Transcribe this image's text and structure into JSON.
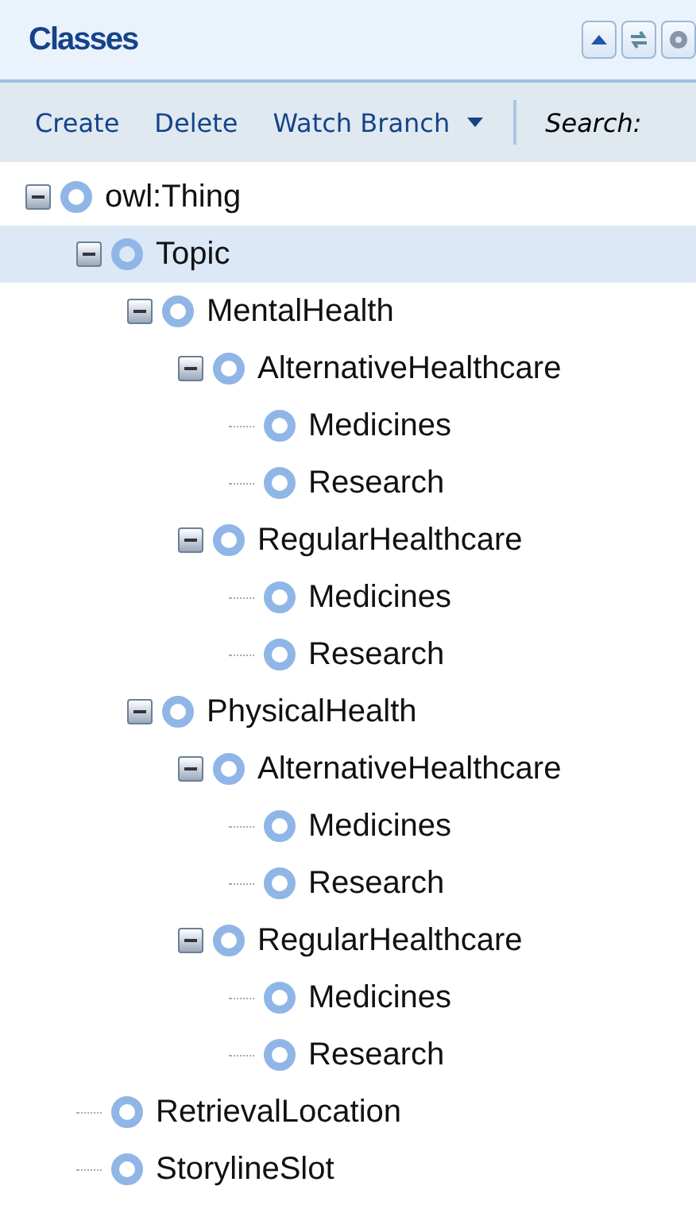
{
  "panel": {
    "title": "Classes"
  },
  "header_buttons": [
    {
      "kind": "up"
    },
    {
      "kind": "sync"
    },
    {
      "kind": "settings"
    }
  ],
  "toolbar": {
    "actions": [
      "Create",
      "Delete"
    ],
    "dropdown": "Watch Branch",
    "search_label": "Search:"
  },
  "tree": [
    {
      "label": "owl:Thing",
      "selected": false,
      "expanded": true,
      "children": [
        {
          "label": "Topic",
          "selected": true,
          "expanded": true,
          "children": [
            {
              "label": "MentalHealth",
              "selected": false,
              "expanded": true,
              "children": [
                {
                  "label": "AlternativeHealthcare",
                  "selected": false,
                  "expanded": true,
                  "children": [
                    {
                      "label": "Medicines",
                      "selected": false
                    },
                    {
                      "label": "Research",
                      "selected": false
                    }
                  ]
                },
                {
                  "label": "RegularHealthcare",
                  "selected": false,
                  "expanded": true,
                  "children": [
                    {
                      "label": "Medicines",
                      "selected": false
                    },
                    {
                      "label": "Research",
                      "selected": false
                    }
                  ]
                }
              ]
            },
            {
              "label": "PhysicalHealth",
              "selected": false,
              "expanded": true,
              "children": [
                {
                  "label": "AlternativeHealthcare",
                  "selected": false,
                  "expanded": true,
                  "children": [
                    {
                      "label": "Medicines",
                      "selected": false
                    },
                    {
                      "label": "Research",
                      "selected": false
                    }
                  ]
                },
                {
                  "label": "RegularHealthcare",
                  "selected": false,
                  "expanded": true,
                  "children": [
                    {
                      "label": "Medicines",
                      "selected": false
                    },
                    {
                      "label": "Research",
                      "selected": false
                    }
                  ]
                }
              ]
            }
          ]
        },
        {
          "label": "RetrievalLocation",
          "selected": false
        },
        {
          "label": "StorylineSlot",
          "selected": false
        }
      ]
    }
  ]
}
